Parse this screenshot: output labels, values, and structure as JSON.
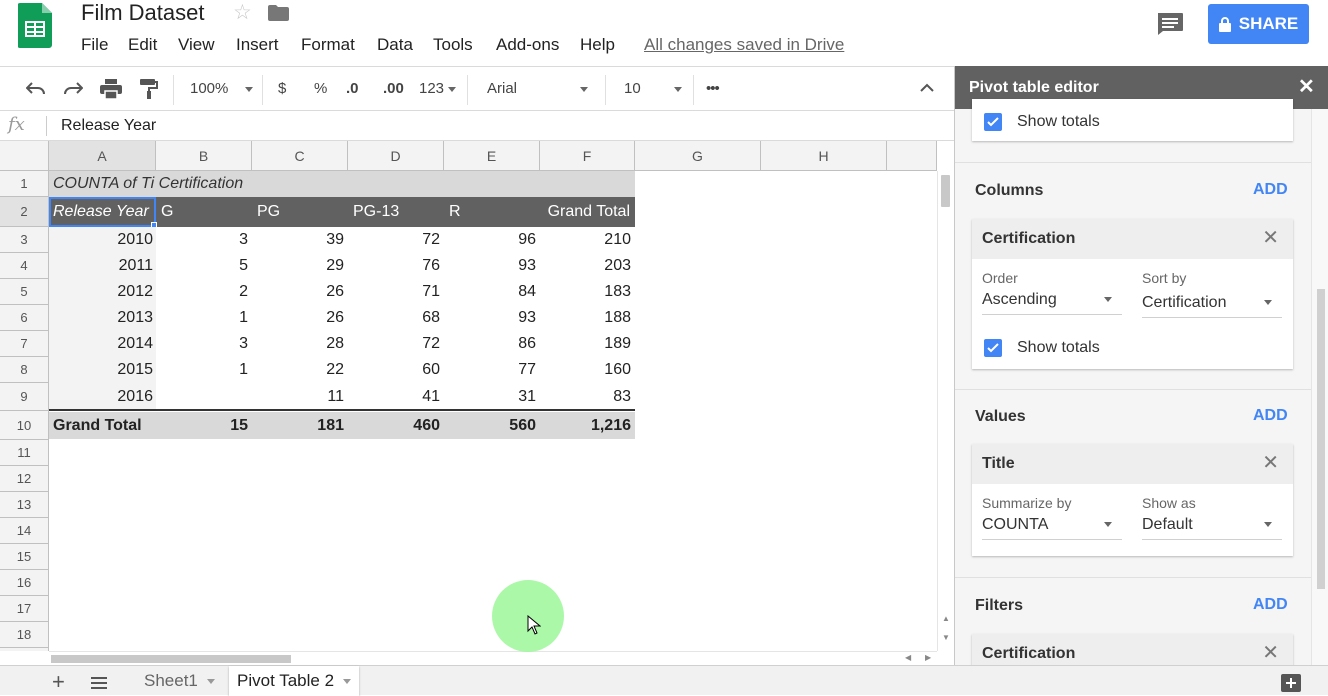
{
  "header": {
    "doc_title": "Film Dataset",
    "menus": [
      "File",
      "Edit",
      "View",
      "Insert",
      "Format",
      "Data",
      "Tools",
      "Add-ons",
      "Help"
    ],
    "saved_status": "All changes saved in Drive",
    "share_label": "SHARE"
  },
  "toolbar": {
    "zoom": "100%",
    "currency": "$",
    "percent": "%",
    "decrease_decimals": ".0",
    "increase_decimals": ".00",
    "more_formats": "123",
    "font": "Arial",
    "font_size": "10",
    "more": "•••"
  },
  "formula_bar": {
    "fx": "fx",
    "value": "Release Year"
  },
  "grid": {
    "columns": [
      "A",
      "B",
      "C",
      "D",
      "E",
      "F",
      "G",
      "H"
    ],
    "rows": [
      "1",
      "2",
      "3",
      "4",
      "5",
      "6",
      "7",
      "8",
      "9",
      "10",
      "11",
      "12",
      "13",
      "14",
      "15",
      "16",
      "17",
      "18"
    ],
    "pivot_title": "COUNTA of Ti Certification",
    "header_row": [
      "Release Year",
      "G",
      "PG",
      "PG-13",
      "R",
      "Grand Total"
    ],
    "data_rows": [
      [
        "2010",
        "3",
        "39",
        "72",
        "96",
        "210"
      ],
      [
        "2011",
        "5",
        "29",
        "76",
        "93",
        "203"
      ],
      [
        "2012",
        "2",
        "26",
        "71",
        "84",
        "183"
      ],
      [
        "2013",
        "1",
        "26",
        "68",
        "93",
        "188"
      ],
      [
        "2014",
        "3",
        "28",
        "72",
        "86",
        "189"
      ],
      [
        "2015",
        "1",
        "22",
        "60",
        "77",
        "160"
      ],
      [
        "2016",
        "",
        "11",
        "41",
        "31",
        "83"
      ]
    ],
    "total_row": [
      "Grand Total",
      "15",
      "181",
      "460",
      "560",
      "1,216"
    ]
  },
  "sheet_tabs": {
    "tabs": [
      "Sheet1",
      "Pivot Table 2"
    ],
    "active": "Pivot Table 2"
  },
  "pivot_editor": {
    "title": "Pivot table editor",
    "rows_show_totals": "Show totals",
    "columns": {
      "label": "Columns",
      "add": "ADD",
      "field": "Certification",
      "order_label": "Order",
      "order_value": "Ascending",
      "sort_label": "Sort by",
      "sort_value": "Certification",
      "show_totals": "Show totals"
    },
    "values": {
      "label": "Values",
      "add": "ADD",
      "field": "Title",
      "summarize_label": "Summarize by",
      "summarize_value": "COUNTA",
      "show_as_label": "Show as",
      "show_as_value": "Default"
    },
    "filters": {
      "label": "Filters",
      "add": "ADD",
      "field": "Certification"
    }
  },
  "colors": {
    "accent": "#4285f4",
    "sheets_green": "#0f9d58",
    "pivot_header_bg": "#616161"
  }
}
